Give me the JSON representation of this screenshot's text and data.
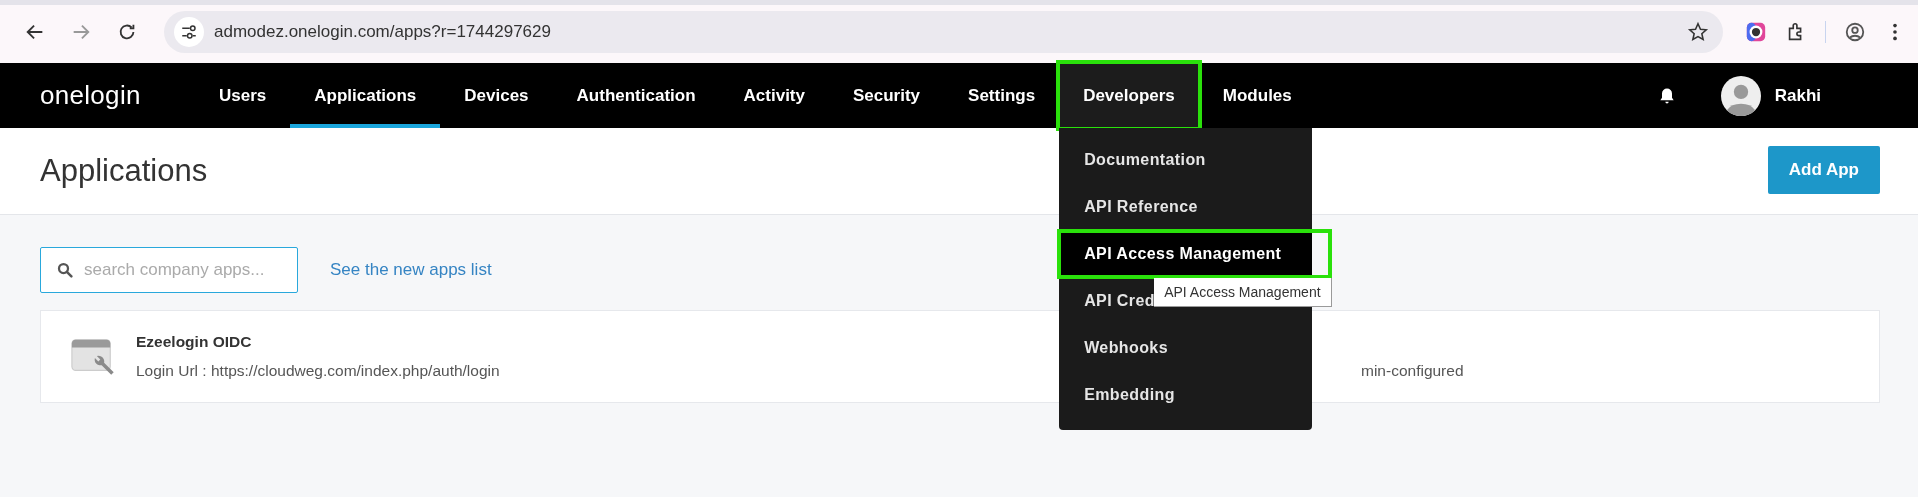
{
  "browser": {
    "url": "admodez.onelogin.com/apps?r=1744297629"
  },
  "nav": {
    "logo": "onelogin",
    "items": [
      {
        "label": "Users",
        "selected": false,
        "expanded": false,
        "highlighted": false
      },
      {
        "label": "Applications",
        "selected": true,
        "expanded": false,
        "highlighted": false
      },
      {
        "label": "Devices",
        "selected": false,
        "expanded": false,
        "highlighted": false
      },
      {
        "label": "Authentication",
        "selected": false,
        "expanded": false,
        "highlighted": false
      },
      {
        "label": "Activity",
        "selected": false,
        "expanded": false,
        "highlighted": false
      },
      {
        "label": "Security",
        "selected": false,
        "expanded": false,
        "highlighted": false
      },
      {
        "label": "Settings",
        "selected": false,
        "expanded": false,
        "highlighted": false
      },
      {
        "label": "Developers",
        "selected": false,
        "expanded": true,
        "highlighted": true
      },
      {
        "label": "Modules",
        "selected": false,
        "expanded": false,
        "highlighted": false
      }
    ],
    "user": {
      "name": "Rakhi"
    }
  },
  "dropdown": {
    "items": [
      {
        "label": "Documentation",
        "selected": false,
        "highlighted": false
      },
      {
        "label": "API Reference",
        "selected": false,
        "highlighted": false
      },
      {
        "label": "API Access Management",
        "selected": true,
        "highlighted": true
      },
      {
        "label": "API Cred",
        "selected": false,
        "highlighted": false
      },
      {
        "label": "Webhooks",
        "selected": false,
        "highlighted": false
      },
      {
        "label": "Embedding",
        "selected": false,
        "highlighted": false
      }
    ],
    "tooltip": "API Access Management"
  },
  "page": {
    "title": "Applications",
    "add_button": "Add App",
    "search": {
      "placeholder": "search company apps..."
    },
    "link": "See the new apps list",
    "apps": [
      {
        "name": "Ezeelogin OIDC",
        "detail": "Login Url : https://cloudweg.com/index.php/auth/login",
        "column_2": "min-configured"
      }
    ]
  }
}
